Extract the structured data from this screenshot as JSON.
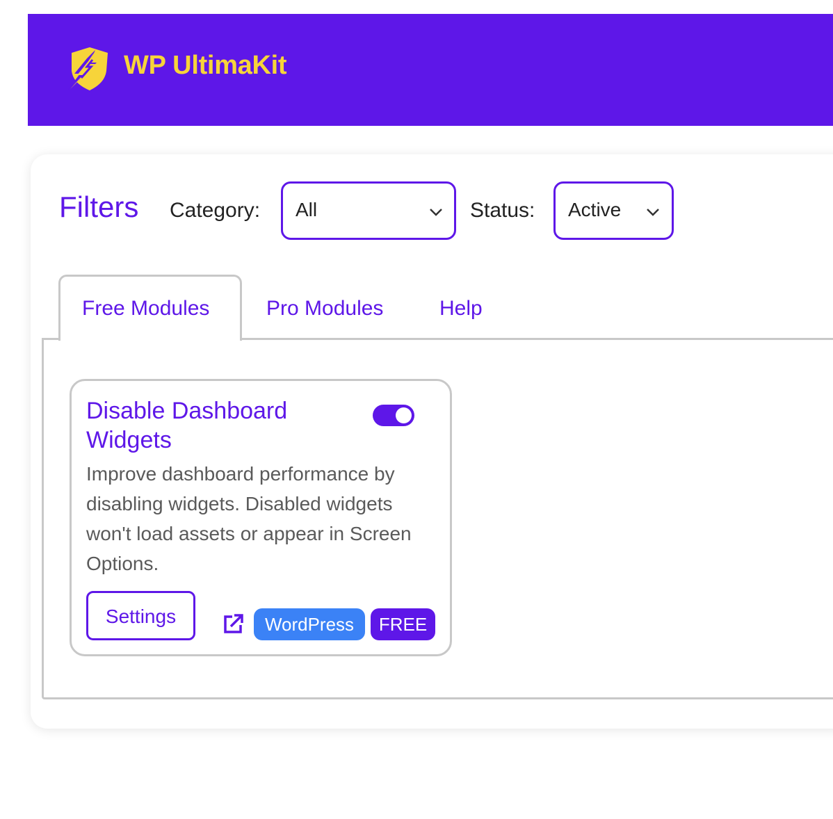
{
  "header": {
    "brand": "WP UltimaKit",
    "logo_icon": "lightning-shield-icon",
    "background_color": "#5e17e8",
    "brand_color": "#f7d43a"
  },
  "filters": {
    "title": "Filters",
    "category_label": "Category:",
    "category_value": "All",
    "status_label": "Status:",
    "status_value": "Active"
  },
  "tabs": [
    {
      "label": "Free Modules",
      "active": true
    },
    {
      "label": "Pro Modules",
      "active": false
    },
    {
      "label": "Help",
      "active": false
    }
  ],
  "module": {
    "title": "Disable Dashboard Widgets",
    "enabled": true,
    "description": "Improve dashboard performance by disabling widgets. Disabled widgets won't load assets or appear in Screen Options.",
    "settings_label": "Settings",
    "external_link_icon": "external-link-icon",
    "badges": [
      {
        "label": "WordPress",
        "color": "#3b82f6"
      },
      {
        "label": "FREE",
        "color": "#5e17e8"
      }
    ]
  }
}
